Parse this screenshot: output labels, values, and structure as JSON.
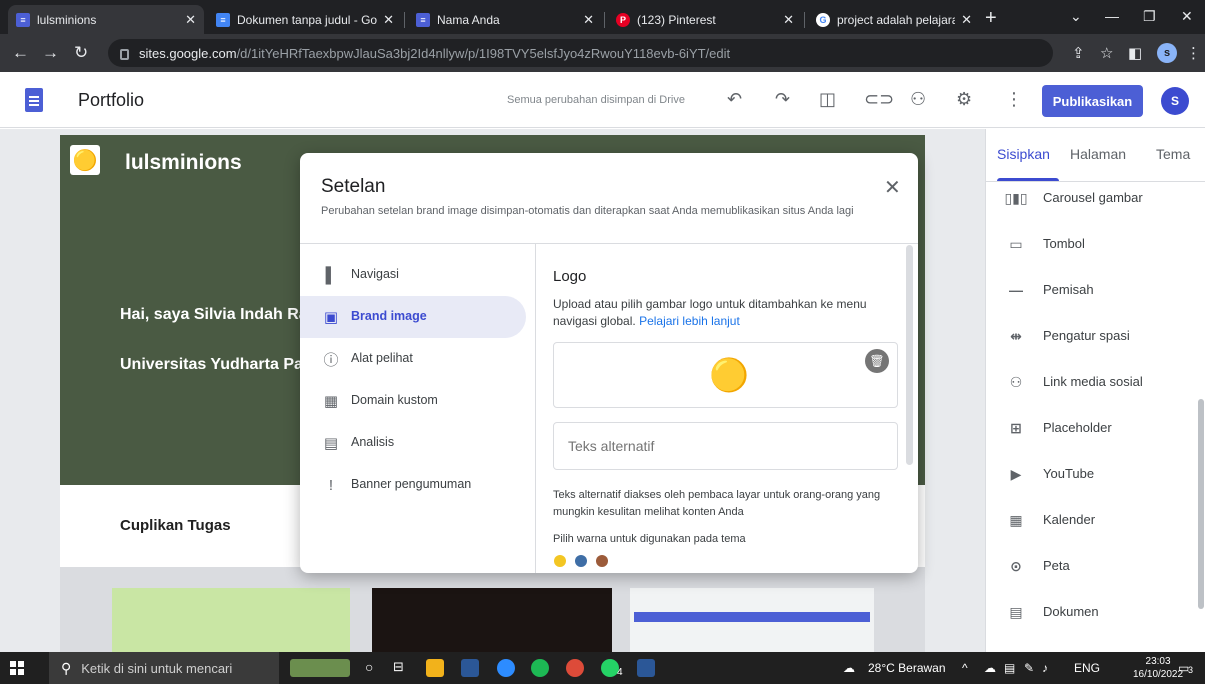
{
  "browser": {
    "tabs": [
      {
        "title": "lulsminions",
        "favicon_color": "#4c5fd5",
        "active": true
      },
      {
        "title": "Dokumen tanpa judul - Goog",
        "favicon_color": "#4285f4",
        "active": false
      },
      {
        "title": "Nama Anda",
        "favicon_color": "#4c5fd5",
        "active": false
      },
      {
        "title": "(123) Pinterest",
        "favicon_color": "#e60023",
        "active": false
      },
      {
        "title": "project adalah pelajaran - Pe",
        "favicon_color": "#ffffff",
        "active": false
      }
    ],
    "url_host": "sites.google.com",
    "url_path": "/d/1itYeHRfTaexbpwJlauSa3bj2Id4nllyw/p/1I98TVY5elsfJyo4zRwouY118evb-6iYT/edit",
    "profile_initial": "s"
  },
  "sites_header": {
    "title": "Portfolio",
    "save_status": "Semua perubahan disimpan di Drive",
    "publish_label": "Publikasikan",
    "avatar_initial": "S"
  },
  "site": {
    "name": "lulsminions",
    "hero_line1": "Hai, saya Silvia Indah Ra",
    "hero_line2": "Universitas Yudharta Pa",
    "section_title": "Cuplikan Tugas",
    "hero_color": "#4a5a43"
  },
  "modal": {
    "title": "Setelan",
    "description": "Perubahan setelan brand image disimpan-otomatis dan diterapkan saat Anda memublikasikan situs Anda lagi",
    "nav": [
      {
        "label": "Navigasi",
        "icon": "navigation-icon",
        "glyph": "▌",
        "selected": false
      },
      {
        "label": "Brand image",
        "icon": "brand-image-icon",
        "glyph": "▣",
        "selected": true
      },
      {
        "label": "Alat pelihat",
        "icon": "info-icon",
        "glyph": "ⓘ",
        "selected": false
      },
      {
        "label": "Domain kustom",
        "icon": "domain-icon",
        "glyph": "▦",
        "selected": false
      },
      {
        "label": "Analisis",
        "icon": "analytics-icon",
        "glyph": "▤",
        "selected": false
      },
      {
        "label": "Banner pengumuman",
        "icon": "announcement-icon",
        "glyph": "!",
        "selected": false
      }
    ],
    "logo_title": "Logo",
    "logo_description": "Upload atau pilih gambar logo untuk ditambahkan ke menu navigasi global.",
    "logo_link": "Pelajari lebih lanjut",
    "alt_placeholder": "Teks alternatif",
    "alt_help": "Teks alternatif diakses oleh pembaca layar untuk orang-orang yang mungkin kesulitan melihat konten Anda",
    "color_label": "Pilih warna untuk digunakan pada tema",
    "theme_colors": [
      "#f3c623",
      "#3f6ea6",
      "#9c5b3a"
    ]
  },
  "right_panel": {
    "tabs": [
      {
        "label": "Sisipkan",
        "selected": true
      },
      {
        "label": "Halaman",
        "selected": false
      },
      {
        "label": "Tema",
        "selected": false
      }
    ],
    "items": [
      {
        "label": "Carousel gambar",
        "icon": "carousel-icon",
        "glyph": "▯▮▯"
      },
      {
        "label": "Tombol",
        "icon": "button-icon",
        "glyph": "▭"
      },
      {
        "label": "Pemisah",
        "icon": "divider-icon",
        "glyph": "—"
      },
      {
        "label": "Pengatur spasi",
        "icon": "spacer-icon",
        "glyph": "⇹"
      },
      {
        "label": "Link media sosial",
        "icon": "social-links-icon",
        "glyph": "⚇"
      },
      {
        "label": "Placeholder",
        "icon": "placeholder-icon",
        "glyph": "⊞"
      },
      {
        "label": "YouTube",
        "icon": "youtube-icon",
        "glyph": "▶"
      },
      {
        "label": "Kalender",
        "icon": "calendar-icon",
        "glyph": "▦"
      },
      {
        "label": "Peta",
        "icon": "map-pin-icon",
        "glyph": "⊙"
      },
      {
        "label": "Dokumen",
        "icon": "docs-icon",
        "glyph": "▤"
      }
    ]
  },
  "taskbar": {
    "search_placeholder": "Ketik di sini untuk mencari",
    "weather": "28°C Berawan",
    "language": "ENG",
    "time": "23:03",
    "date": "16/10/2022",
    "notification_count": "3",
    "whatsapp_badge": "4"
  }
}
